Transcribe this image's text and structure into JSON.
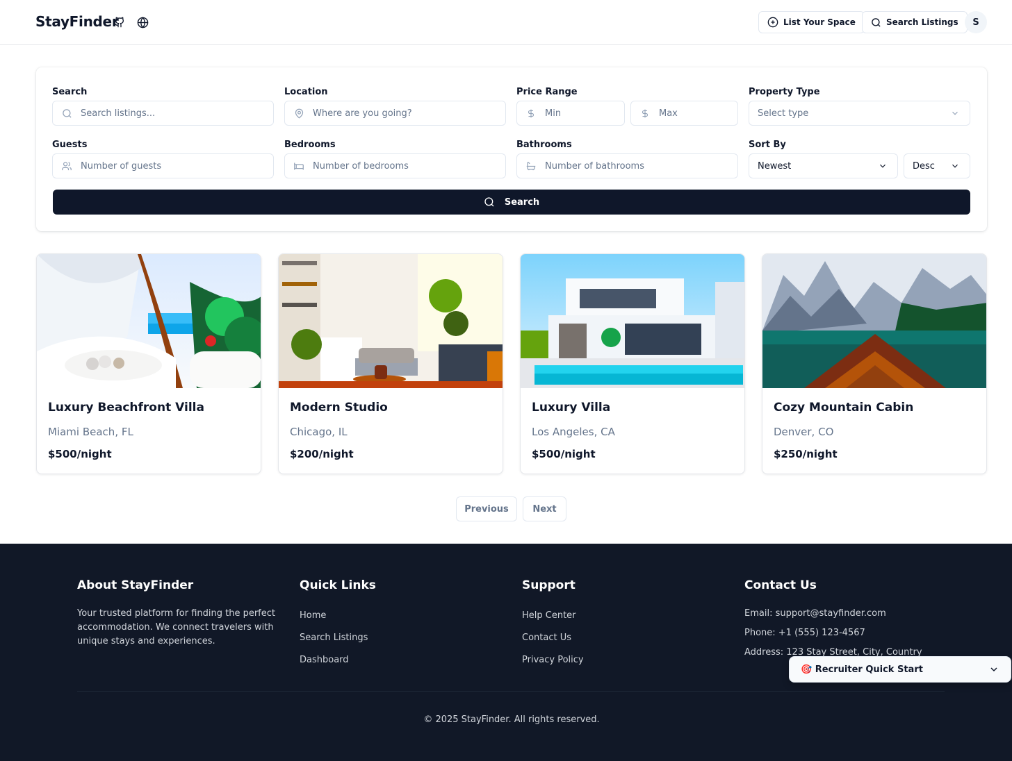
{
  "header": {
    "brand": "StayFinder",
    "list_space_label": "List Your Space",
    "search_listings_label": "Search Listings",
    "avatar_initial": "S"
  },
  "filters": {
    "search_label": "Search",
    "search_placeholder": "Search listings...",
    "location_label": "Location",
    "location_placeholder": "Where are you going?",
    "price_label": "Price Range",
    "price_min_placeholder": "Min",
    "price_max_placeholder": "Max",
    "property_type_label": "Property Type",
    "property_type_value": "Select type",
    "guests_label": "Guests",
    "guests_placeholder": "Number of guests",
    "bedrooms_label": "Bedrooms",
    "bedrooms_placeholder": "Number of bedrooms",
    "bathrooms_label": "Bathrooms",
    "bathrooms_placeholder": "Number of bathrooms",
    "sort_label": "Sort By",
    "sort_value": "Newest",
    "order_value": "Desc",
    "search_button": "Search"
  },
  "listings": [
    {
      "title": "Luxury Beachfront Villa",
      "location": "Miami Beach, FL",
      "price": "$500/night"
    },
    {
      "title": "Modern Studio",
      "location": "Chicago, IL",
      "price": "$200/night"
    },
    {
      "title": "Luxury Villa",
      "location": "Los Angeles, CA",
      "price": "$500/night"
    },
    {
      "title": "Cozy Mountain Cabin",
      "location": "Denver, CO",
      "price": "$250/night"
    }
  ],
  "pagination": {
    "previous": "Previous",
    "next": "Next"
  },
  "footer": {
    "about_title": "About StayFinder",
    "about_text": "Your trusted platform for finding the perfect accommodation. We connect travelers with unique stays and experiences.",
    "quick_links_title": "Quick Links",
    "quick_links": [
      "Home",
      "Search Listings",
      "Dashboard"
    ],
    "support_title": "Support",
    "support_links": [
      "Help Center",
      "Contact Us",
      "Privacy Policy"
    ],
    "contact_title": "Contact Us",
    "contact_email": "Email: support@stayfinder.com",
    "contact_phone": "Phone: +1 (555) 123-4567",
    "contact_address": "Address: 123 Stay Street, City, Country",
    "copyright": "© 2025 StayFinder. All rights reserved."
  },
  "recruiter": {
    "label": "🎯 Recruiter Quick Start"
  },
  "colors": {
    "primary": "#0f172a",
    "footer_bg": "#111827",
    "muted": "#64748b",
    "border": "#e2e8f0"
  }
}
